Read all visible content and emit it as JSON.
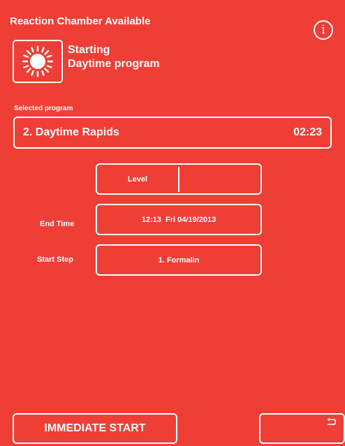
{
  "header": {
    "title": "Reaction Chamber Available",
    "info_icon": "info-icon",
    "info_glyph": "i"
  },
  "status": {
    "icon": "sun-icon",
    "line1": "Starting",
    "line2": "Daytime program"
  },
  "program": {
    "label": "Selected program",
    "name": "2. Daytime Rapids",
    "duration": "02:23"
  },
  "level": {
    "label": "Level",
    "value": ""
  },
  "end_time": {
    "label": "End Time",
    "value": "12:13  Fri 04/19/2013"
  },
  "start_step": {
    "label": "Start Step",
    "value": "1. Formalin"
  },
  "footer": {
    "immediate_start_label": "IMMEDIATE START",
    "back_icon": "return-arrow-icon"
  },
  "colors": {
    "background": "#ef3e36",
    "foreground": "#ffffff"
  }
}
